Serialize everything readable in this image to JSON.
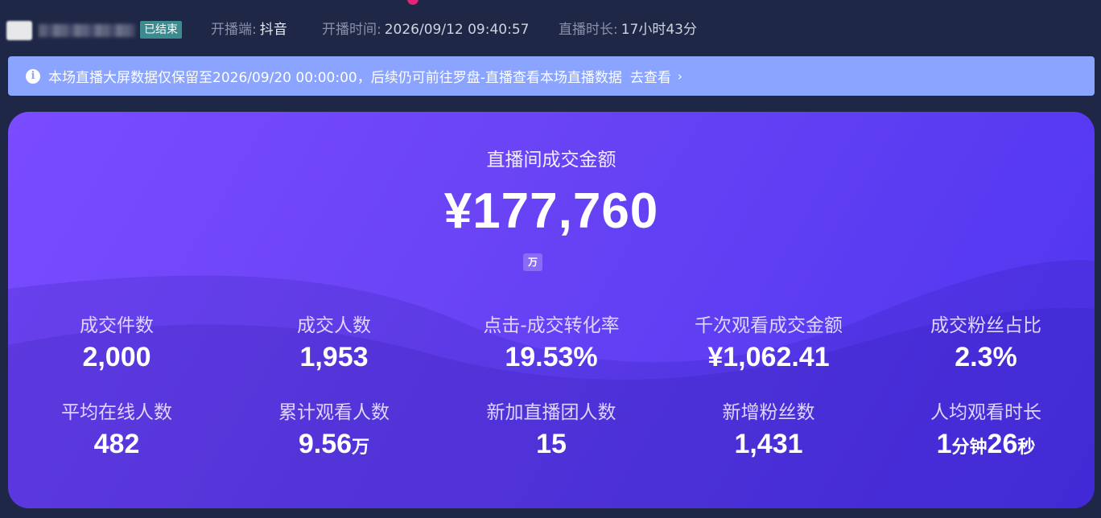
{
  "header": {
    "status": "已结束",
    "platform_label": "开播端:",
    "platform_value": "抖音",
    "start_label": "开播时间:",
    "start_value": "2026/09/12 09:40:57",
    "duration_label": "直播时长:",
    "duration_value": "17小时43分"
  },
  "notice": {
    "text": "本场直播大屏数据仅保留至2026/09/20 00:00:00，后续仍可前往罗盘-直播查看本场直播数据",
    "link": "去查看",
    "icon": "info-icon"
  },
  "panel": {
    "title": "直播间成交金额",
    "amount": "¥177,760",
    "unit_toggle": "万"
  },
  "metrics": [
    {
      "label": "成交件数",
      "value": "2,000",
      "unit": ""
    },
    {
      "label": "成交人数",
      "value": "1,953",
      "unit": ""
    },
    {
      "label": "点击-成交转化率",
      "value": "19.53%",
      "unit": ""
    },
    {
      "label": "千次观看成交金额",
      "value": "¥1,062.41",
      "unit": ""
    },
    {
      "label": "成交粉丝占比",
      "value": "2.3%",
      "unit": ""
    },
    {
      "label": "平均在线人数",
      "value": "482",
      "unit": ""
    },
    {
      "label": "累计观看人数",
      "value": "9.56",
      "unit": "万"
    },
    {
      "label": "新加直播团人数",
      "value": "15",
      "unit": ""
    },
    {
      "label": "新增粉丝数",
      "value": "1,431",
      "unit": ""
    },
    {
      "label": "人均观看时长",
      "value": "1",
      "unit": "分钟",
      "value2": "26",
      "unit2": "秒"
    }
  ],
  "colors": {
    "background": "#1f2747",
    "notice": "#8aa4ff",
    "panel_start": "#7a4bff",
    "panel_end": "#4f35f0",
    "badge": "#3d8a8f"
  }
}
